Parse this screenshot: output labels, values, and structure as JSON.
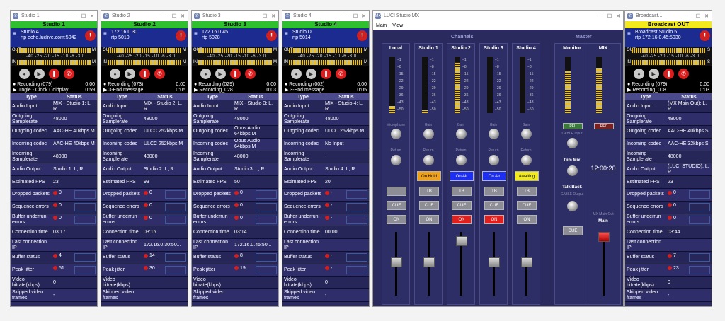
{
  "studios": [
    {
      "win_title": "Studio 1",
      "label": "Studio 1",
      "label_color": "#2ec02e",
      "line1": "Studio A",
      "line2": "rtp echo.luclive.com:5042",
      "scale": "-40 -25 -20 -15 -10 -6 -3 0",
      "out": "OUT",
      "in": "IN",
      "m": "M",
      "rec": "Recording (079)",
      "rec_time": "0:00",
      "play": "Jingle - Clock Coldplay",
      "play_time": "0:59",
      "rows": [
        [
          "Audio Input",
          "MIX - Studio 1: L, R"
        ],
        [
          "Outgoing Samplerate",
          "48000"
        ],
        [
          "Outgoing codec",
          "AAC-HE 40kbps M"
        ],
        [
          "Incoming codec",
          "AAC-HE 40kbps M"
        ],
        [
          "Incoming Samplerate",
          "48000"
        ],
        [
          "Audio Output",
          "Studio 1: L, R"
        ],
        [
          "Estimated FPS",
          "23"
        ],
        [
          "Dropped packets",
          "0"
        ],
        [
          "Sequence errors",
          "0"
        ],
        [
          "Buffer underrun errors",
          "0"
        ],
        [
          "Connection time",
          "03:17"
        ],
        [
          "Last connection IP",
          ""
        ],
        [
          "Buffer status",
          "4"
        ],
        [
          "Peak jitter",
          "51"
        ],
        [
          "Video bitrate(kbps)",
          "0"
        ],
        [
          "Skipped video frames",
          "-"
        ]
      ]
    },
    {
      "win_title": "Studio 2",
      "label": "Studio 2",
      "label_color": "#2ec02e",
      "line1": "172.16.0.30",
      "line2": "rtp 5010",
      "scale": "-40 -25 -20 -15 -10 -6 -3 0",
      "out": "OUT",
      "in": "IN",
      "m": "M",
      "rec": "Recording (073)",
      "rec_time": "0:00",
      "play": "3-End message",
      "play_time": "0:05",
      "rows": [
        [
          "Audio Input",
          "MIX - Studio 2: L, R"
        ],
        [
          "Outgoing Samplerate",
          "48000"
        ],
        [
          "Outgoing codec",
          "ULCC 252kbps M"
        ],
        [
          "Incoming codec",
          "ULCC 252kbps M"
        ],
        [
          "Incoming Samplerate",
          "48000"
        ],
        [
          "Audio Output",
          "Studio 2: L, R"
        ],
        [
          "Estimated FPS",
          "93"
        ],
        [
          "Dropped packets",
          "0"
        ],
        [
          "Sequence errors",
          "0"
        ],
        [
          "Buffer underrun errors",
          "0"
        ],
        [
          "Connection time",
          "03:16"
        ],
        [
          "Last connection IP",
          "172.16.0.30:50..."
        ],
        [
          "Buffer status",
          "14"
        ],
        [
          "Peak jitter",
          "30"
        ],
        [
          "Video bitrate(kbps)",
          ""
        ],
        [
          "Skipped video frames",
          ""
        ]
      ]
    },
    {
      "win_title": "Studio 3",
      "label": "Studio 3",
      "label_color": "#2ec02e",
      "line1": "172.16.0.45",
      "line2": "rtp 5028",
      "scale": "-40 -25 -20 -15 -10 -6 -3 0",
      "out": "OUT",
      "in": "IN",
      "m": "M",
      "rec": "Recording (029)",
      "rec_time": "0:00",
      "play": "Recording_028",
      "play_time": "0:03",
      "rows": [
        [
          "Audio Input",
          "MIX - Studio 3: L, R"
        ],
        [
          "Outgoing Samplerate",
          "48000"
        ],
        [
          "Outgoing codec",
          "Opus Audio 64kbps M"
        ],
        [
          "Incoming codec",
          "Opus Audio 64kbps M"
        ],
        [
          "Incoming Samplerate",
          "48000"
        ],
        [
          "Audio Output",
          "Studio 3: L, R"
        ],
        [
          "Estimated FPS",
          "50"
        ],
        [
          "Dropped packets",
          "0"
        ],
        [
          "Sequence errors",
          "0"
        ],
        [
          "Buffer underrun errors",
          "0"
        ],
        [
          "Connection time",
          "03:14"
        ],
        [
          "Last connection IP",
          "172.16.0.45:50..."
        ],
        [
          "Buffer status",
          "8"
        ],
        [
          "Peak jitter",
          "19"
        ],
        [
          "Video bitrate(kbps)",
          ""
        ],
        [
          "Skipped video frames",
          ""
        ]
      ]
    },
    {
      "win_title": "Studio 4",
      "label": "Studio 4",
      "label_color": "#2ec02e",
      "line1": "Studio D",
      "line2": "rtp 5014",
      "scale": "-40 -25 -20 -15 -10 -6 -3 0",
      "out": "OUT",
      "in": "IN",
      "m": "M",
      "rec": "Recording (002)",
      "rec_time": "0:00",
      "play": "3-End message",
      "play_time": "0:05",
      "rows": [
        [
          "Audio Input",
          "MIX - Studio 4: L, R"
        ],
        [
          "Outgoing Samplerate",
          "48000"
        ],
        [
          "Outgoing codec",
          "ULCC 252kbps M"
        ],
        [
          "Incoming codec",
          "No Input"
        ],
        [
          "Incoming Samplerate",
          "-"
        ],
        [
          "Audio Output",
          "Studio 4: L, R"
        ],
        [
          "Estimated FPS",
          "20"
        ],
        [
          "Dropped packets",
          "-"
        ],
        [
          "Sequence errors",
          "-"
        ],
        [
          "Buffer underrun errors",
          "-"
        ],
        [
          "Connection time",
          "00:00"
        ],
        [
          "Last connection IP",
          ""
        ],
        [
          "Buffer status",
          "-"
        ],
        [
          "Peak jitter",
          "-"
        ],
        [
          "Video bitrate(kbps)",
          "0"
        ],
        [
          "Skipped video frames",
          "-"
        ]
      ]
    },
    {
      "win_title": "Broadcast...",
      "label": "Broadcast OUT",
      "label_color": "#f2ea1c",
      "line1": "Broadcast Studio 5",
      "line2": "rtp 172.16.0.45:5030",
      "scale": "-40 -25 -20 -15 -10 -6 -3 0",
      "out": "OUT",
      "in": "IN",
      "m": "S",
      "rec": "Recording (079)",
      "rec_time": "0:00",
      "play": "Recording_008",
      "play_time": "0:03",
      "rows": [
        [
          "Audio Input",
          "(MX Main Out): L, R"
        ],
        [
          "Outgoing Samplerate",
          "48000"
        ],
        [
          "Outgoing codec",
          "AAC-HE 40kbps S"
        ],
        [
          "Incoming codec",
          "AAC-HE 32kbps S"
        ],
        [
          "Incoming Samplerate",
          "48000"
        ],
        [
          "Audio Output",
          "(LUCI STUDIO): L, R"
        ],
        [
          "Estimated FPS",
          "23"
        ],
        [
          "Dropped packets",
          "0"
        ],
        [
          "Sequence errors",
          "0"
        ],
        [
          "Buffer underrun errors",
          "0"
        ],
        [
          "Connection time",
          "03:44"
        ],
        [
          "Last connection IP",
          ""
        ],
        [
          "Buffer status",
          "7"
        ],
        [
          "Peak jitter",
          "23"
        ],
        [
          "Video bitrate(kbps)",
          "0"
        ],
        [
          "Skipped video frames",
          "-"
        ]
      ]
    }
  ],
  "table_headers": {
    "type": "Type",
    "status": "Status"
  },
  "mixer": {
    "title": "LUCI Studio MX",
    "menu": [
      "Main",
      "View"
    ],
    "channels_label": "Channels",
    "master_label": "Master",
    "db_scale": [
      "−1",
      "−8",
      "−15",
      "−22",
      "−29",
      "−36",
      "−43",
      "−50"
    ],
    "channels": [
      {
        "name": "Local",
        "level": 0.12,
        "knob1": "Microphone",
        "knob2": "Return",
        "status": "",
        "status_color": "",
        "tb": "",
        "cue": "CUE",
        "on": "ON",
        "on_active": false
      },
      {
        "name": "Studio 1",
        "level": 0.05,
        "knob1": "Gain",
        "knob2": "Return",
        "status": "On Hold",
        "status_color": "#f0a11a",
        "tb": "TB",
        "cue": "CUE",
        "on": "ON",
        "on_active": false
      },
      {
        "name": "Studio 2",
        "level": 0.9,
        "knob1": "Gain",
        "knob2": "Return",
        "status": "On Air",
        "status_color": "#1c2ef2",
        "tb": "TB",
        "cue": "CUE",
        "on": "ON",
        "on_active": true
      },
      {
        "name": "Studio 3",
        "level": 0.0,
        "knob1": "Gain",
        "knob2": "Return",
        "status": "On Air",
        "status_color": "#1c2ef2",
        "tb": "TB",
        "cue": "CUE",
        "on": "ON",
        "on_active": true
      },
      {
        "name": "Studio 4",
        "level": 0.0,
        "knob1": "Gain",
        "knob2": "Return",
        "status": "Awaiting",
        "status_color": "#f2ea1c",
        "tb": "TB",
        "cue": "CUE",
        "on": "ON",
        "on_active": false
      }
    ],
    "monitor": {
      "name": "Monitor",
      "level": 0.75,
      "pfl": "PFL",
      "cable_input": "CABLE Input",
      "dim_mix": "Dim Mix",
      "talk_back": "Talk Back",
      "cable_output": "CABLE Output",
      "cue": "CUE"
    },
    "mix": {
      "name": "MIX",
      "level": 0.8,
      "rec": "REC",
      "mix_main_out": "MX Main Out",
      "main": "Main"
    },
    "clock": "12:00:20"
  }
}
